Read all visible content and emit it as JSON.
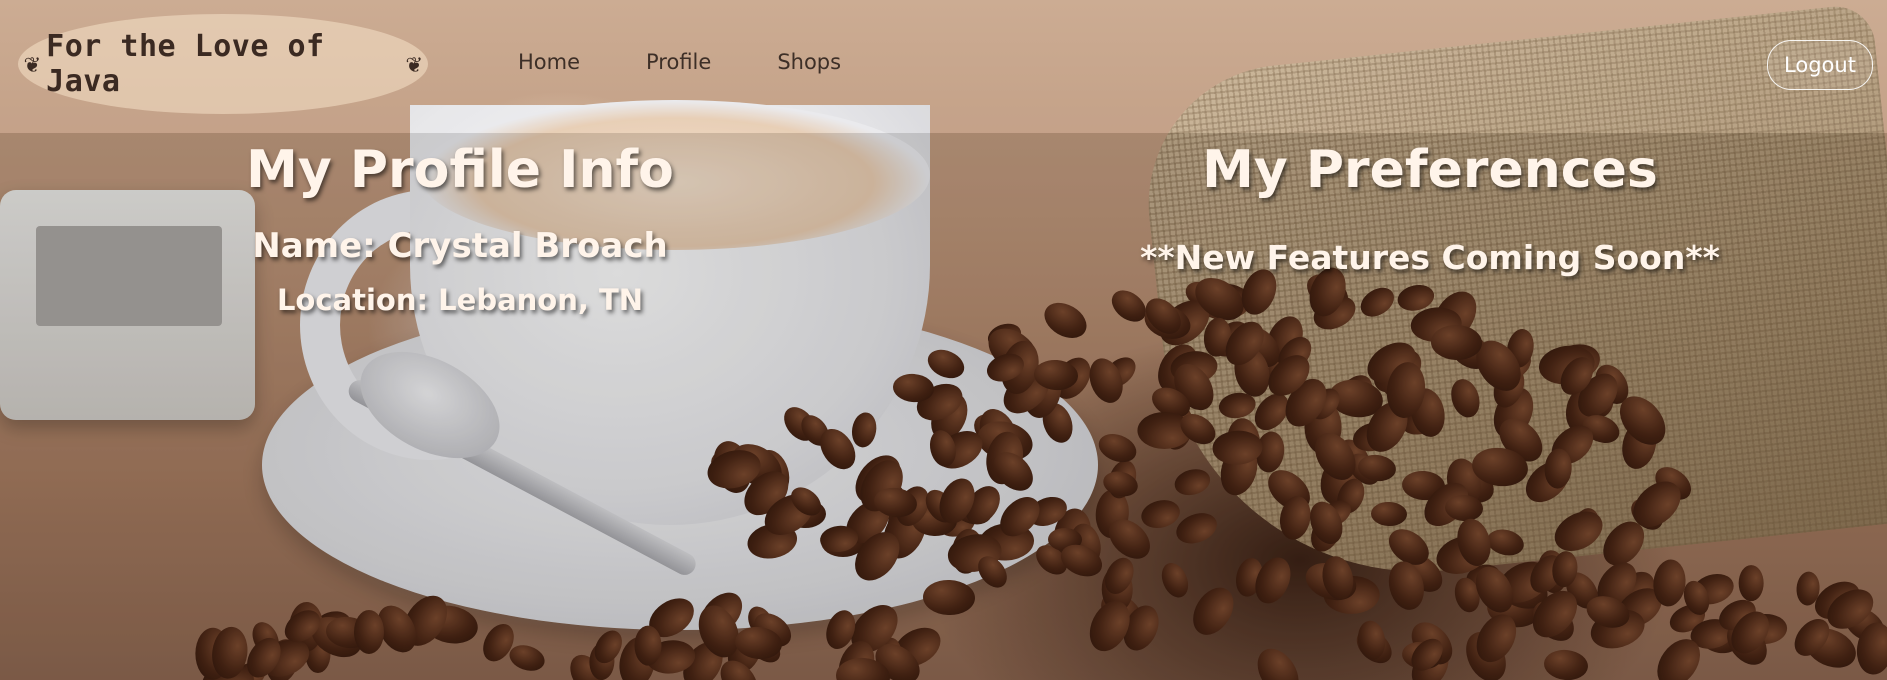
{
  "brand": {
    "title": "For the Love of Java",
    "left_icon": "coffee-bean-icon",
    "right_icon": "coffee-bean-icon"
  },
  "nav": {
    "items": [
      {
        "label": "Home"
      },
      {
        "label": "Profile"
      },
      {
        "label": "Shops"
      }
    ]
  },
  "header": {
    "logout_label": "Logout"
  },
  "profile": {
    "heading": "My Profile Info",
    "name": "Name: Crystal Broach",
    "location": "Location: Lebanon, TN"
  },
  "preferences": {
    "heading": "My Preferences",
    "notice": "**New Features Coming Soon**"
  },
  "colors": {
    "heading_text": "#fff4ea",
    "nav_text": "#3d2f27",
    "brand_badge": "#f5e1c8"
  }
}
